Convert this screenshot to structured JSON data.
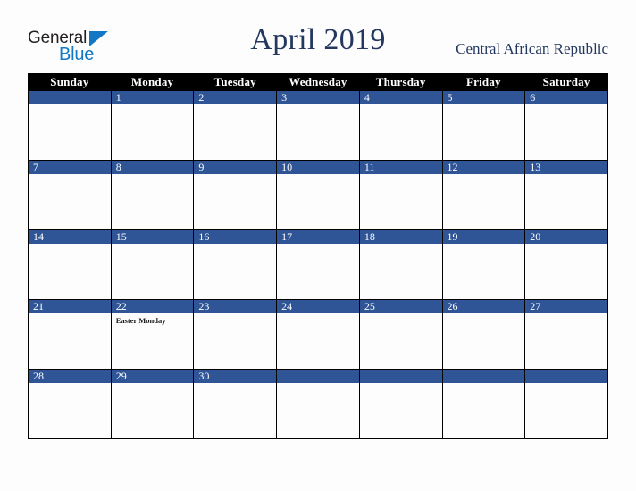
{
  "brand": {
    "word_general": "General",
    "word_blue": "Blue",
    "triangle_color": "#1277c4",
    "general_color": "#231f20"
  },
  "header": {
    "title": "April 2019",
    "country": "Central African Republic",
    "title_color": "#24375f"
  },
  "calendar": {
    "accent_color": "#2f5597",
    "header_bg": "#000000",
    "weekday_headers": [
      "Sunday",
      "Monday",
      "Tuesday",
      "Wednesday",
      "Thursday",
      "Friday",
      "Saturday"
    ],
    "weeks": [
      [
        {
          "day": "",
          "events": []
        },
        {
          "day": "1",
          "events": []
        },
        {
          "day": "2",
          "events": []
        },
        {
          "day": "3",
          "events": []
        },
        {
          "day": "4",
          "events": []
        },
        {
          "day": "5",
          "events": []
        },
        {
          "day": "6",
          "events": []
        }
      ],
      [
        {
          "day": "7",
          "events": []
        },
        {
          "day": "8",
          "events": []
        },
        {
          "day": "9",
          "events": []
        },
        {
          "day": "10",
          "events": []
        },
        {
          "day": "11",
          "events": []
        },
        {
          "day": "12",
          "events": []
        },
        {
          "day": "13",
          "events": []
        }
      ],
      [
        {
          "day": "14",
          "events": []
        },
        {
          "day": "15",
          "events": []
        },
        {
          "day": "16",
          "events": []
        },
        {
          "day": "17",
          "events": []
        },
        {
          "day": "18",
          "events": []
        },
        {
          "day": "19",
          "events": []
        },
        {
          "day": "20",
          "events": []
        }
      ],
      [
        {
          "day": "21",
          "events": []
        },
        {
          "day": "22",
          "events": [
            "Easter Monday"
          ]
        },
        {
          "day": "23",
          "events": []
        },
        {
          "day": "24",
          "events": []
        },
        {
          "day": "25",
          "events": []
        },
        {
          "day": "26",
          "events": []
        },
        {
          "day": "27",
          "events": []
        }
      ],
      [
        {
          "day": "28",
          "events": []
        },
        {
          "day": "29",
          "events": []
        },
        {
          "day": "30",
          "events": []
        },
        {
          "day": "",
          "events": []
        },
        {
          "day": "",
          "events": []
        },
        {
          "day": "",
          "events": []
        },
        {
          "day": "",
          "events": []
        }
      ]
    ]
  }
}
